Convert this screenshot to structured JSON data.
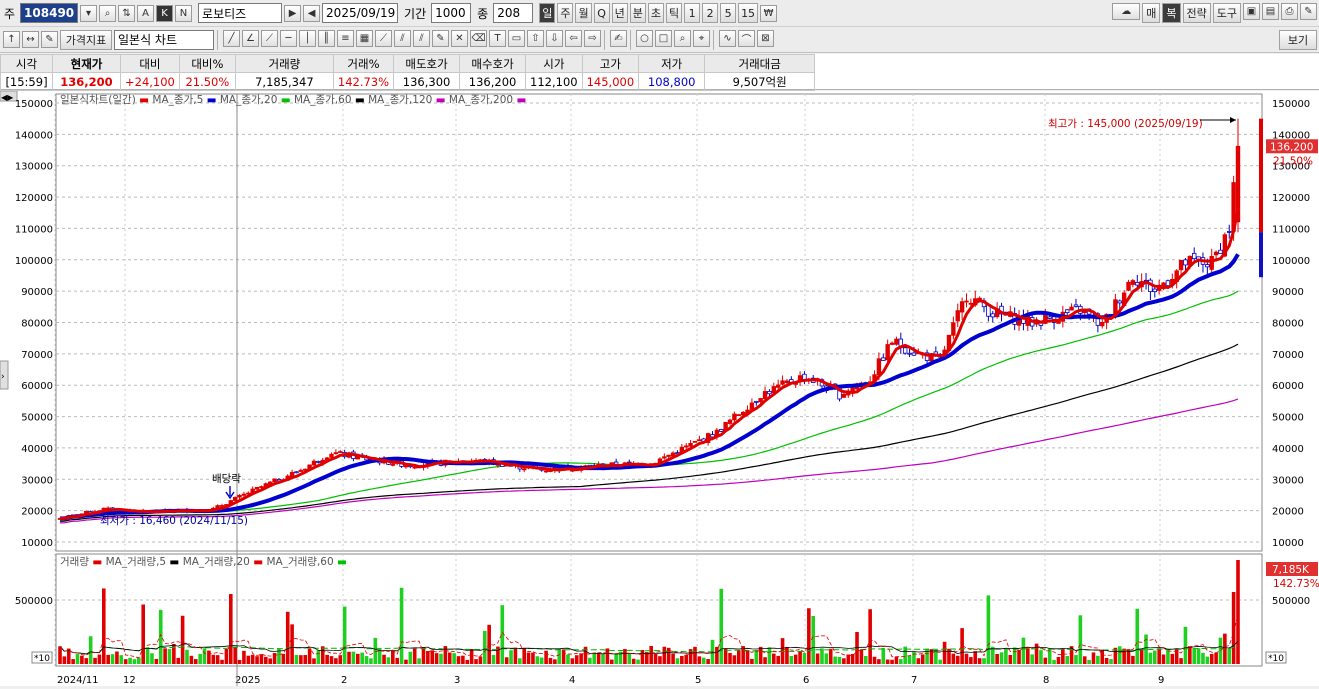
{
  "toolbar1": {
    "code_label": "주",
    "code_value": "108490",
    "stock_name": "로보티즈",
    "date": "2025/09/19",
    "period_label": "기간",
    "period_value": "1000",
    "count_label": "종",
    "count_value": "208",
    "timeframes": [
      "일",
      "주",
      "월",
      "Q",
      "년",
      "분",
      "초",
      "틱",
      "1",
      "2",
      "5",
      "15"
    ],
    "right_buttons": [
      "매",
      "복",
      "전략",
      "도구"
    ]
  },
  "toolbar2": {
    "indicator_label": "가격지표",
    "chart_type": "일본식 차트",
    "view_button": "보기"
  },
  "quote": {
    "headers": [
      "시각",
      "현재가",
      "대비",
      "대비%",
      "거래량",
      "거래%",
      "매도호가",
      "매수호가",
      "시가",
      "고가",
      "저가",
      "거래대금"
    ],
    "values": [
      "[15:59]",
      "136,200",
      "+24,100",
      "21.50%",
      "7,185,347",
      "142.73%",
      "136,300",
      "136,200",
      "112,100",
      "145,000",
      "108,800",
      "9,507억원"
    ]
  },
  "chart": {
    "legend_prefix": "일본식차트(일간)",
    "ma_labels": [
      "MA_종가,5",
      "MA_종가,20",
      "MA_종가,60",
      "MA_종가,120",
      "MA_종가,200"
    ],
    "ma_colors": [
      "#e00000",
      "#0000d0",
      "#00c000",
      "#000000",
      "#c000c0"
    ],
    "high_annotation": "최고가 : 145,000 (2025/09/19)",
    "low_annotation": "최저가 : 16,460 (2024/11/15)",
    "dividend_label": "배당락",
    "last_price_tag": "136,200",
    "last_change_tag": "21.50%",
    "price_ticks": [
      "150000",
      "140000",
      "130000",
      "120000",
      "110000",
      "100000",
      "90000",
      "80000",
      "70000",
      "60000",
      "50000",
      "40000",
      "30000",
      "20000",
      "10000"
    ],
    "volume_legend_prefix": "거래량",
    "volume_ma_labels": [
      "MA_거래량,5",
      "MA_거래량,20",
      "MA_거래량,60"
    ],
    "volume_ticks": [
      "500000",
      "*10"
    ],
    "volume_tag": "7,185K",
    "volume_pct_tag": "142.73%",
    "x_labels": [
      "2024/11",
      "12",
      "2025",
      "2",
      "3",
      "4",
      "5",
      "6",
      "7",
      "8",
      "9"
    ]
  },
  "chart_data": {
    "type": "candlestick",
    "price_range": [
      10000,
      150000
    ],
    "anchors": [
      [
        0,
        17500
      ],
      [
        10,
        20500
      ],
      [
        20,
        19500
      ],
      [
        35,
        20500
      ],
      [
        45,
        27000
      ],
      [
        55,
        33000
      ],
      [
        62,
        38500
      ],
      [
        70,
        36500
      ],
      [
        80,
        34500
      ],
      [
        95,
        36000
      ],
      [
        110,
        33000
      ],
      [
        125,
        34500
      ],
      [
        135,
        35000
      ],
      [
        150,
        45000
      ],
      [
        160,
        57000
      ],
      [
        170,
        63000
      ],
      [
        178,
        57000
      ],
      [
        185,
        62000
      ],
      [
        190,
        74000
      ],
      [
        196,
        70000
      ],
      [
        201,
        68000
      ],
      [
        207,
        89000
      ],
      [
        213,
        83000
      ],
      [
        222,
        80000
      ],
      [
        233,
        84000
      ],
      [
        238,
        79000
      ],
      [
        245,
        95000
      ],
      [
        250,
        90000
      ],
      [
        257,
        99000
      ],
      [
        263,
        99000
      ],
      [
        267,
        110000
      ],
      [
        269,
        136200
      ]
    ]
  }
}
